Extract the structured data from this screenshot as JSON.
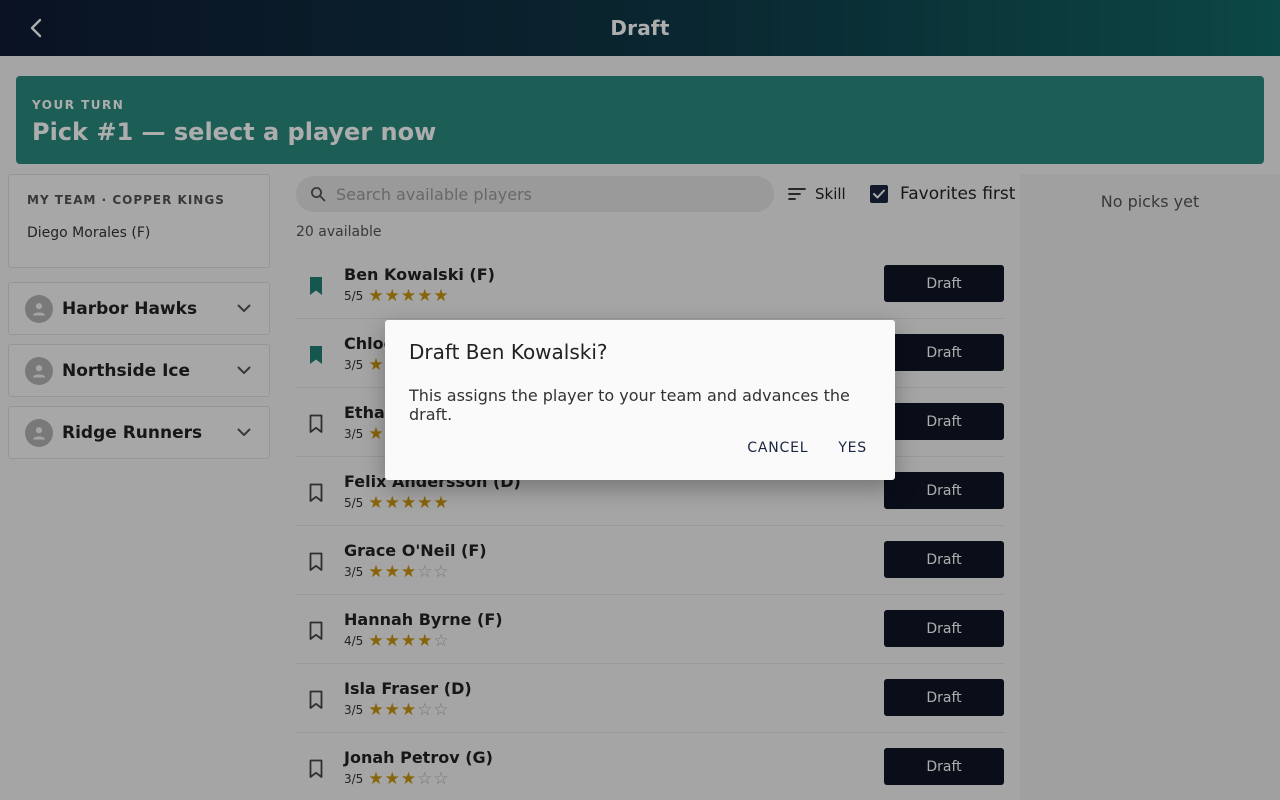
{
  "header": {
    "title": "Draft",
    "back_icon": "chevron-left-icon"
  },
  "banner": {
    "eyebrow": "YOUR TURN",
    "headline": "Pick #1 — select a player now",
    "color": "#2a8a7e"
  },
  "my_team": {
    "label": "MY TEAM · COPPER KINGS",
    "members": [
      "Diego Morales (F)"
    ]
  },
  "other_teams": [
    {
      "name": "Harbor Hawks",
      "icon": "person-icon",
      "expand_icon": "chevron-down-icon"
    },
    {
      "name": "Northside Ice",
      "icon": "person-icon",
      "expand_icon": "chevron-down-icon"
    },
    {
      "name": "Ridge Runners",
      "icon": "person-icon",
      "expand_icon": "chevron-down-icon"
    }
  ],
  "toolbar": {
    "search_placeholder": "Search available players",
    "sort_label": "Skill",
    "favorites_label": "Favorites first",
    "favorites_checked": true
  },
  "available_count": "20 available",
  "players": [
    {
      "name": "Ben Kowalski (F)",
      "rating_text": "5/5",
      "rating": 5,
      "bookmarked": true,
      "button": "Draft"
    },
    {
      "name": "Chloe",
      "rating_text": "3/5",
      "rating": 3,
      "bookmarked": true,
      "button": "Draft"
    },
    {
      "name": "Ethan",
      "rating_text": "3/5",
      "rating": 3,
      "bookmarked": false,
      "button": "Draft"
    },
    {
      "name": "Felix Andersson (D)",
      "rating_text": "5/5",
      "rating": 5,
      "bookmarked": false,
      "button": "Draft"
    },
    {
      "name": "Grace O'Neil (F)",
      "rating_text": "3/5",
      "rating": 3,
      "bookmarked": false,
      "button": "Draft"
    },
    {
      "name": "Hannah Byrne (F)",
      "rating_text": "4/5",
      "rating": 4,
      "bookmarked": false,
      "button": "Draft"
    },
    {
      "name": "Isla Fraser (D)",
      "rating_text": "3/5",
      "rating": 3,
      "bookmarked": false,
      "button": "Draft"
    },
    {
      "name": "Jonah Petrov (G)",
      "rating_text": "3/5",
      "rating": 3,
      "bookmarked": false,
      "button": "Draft"
    }
  ],
  "picks_panel": {
    "empty_text": "No picks yet"
  },
  "dialog": {
    "title": "Draft Ben Kowalski?",
    "body": "This assigns the player to your team and advances the draft.",
    "cancel_label": "CANCEL",
    "confirm_label": "YES"
  },
  "colors": {
    "accent": "#2a8a7e",
    "button_dark": "#0e1526",
    "star": "#c9940f"
  }
}
